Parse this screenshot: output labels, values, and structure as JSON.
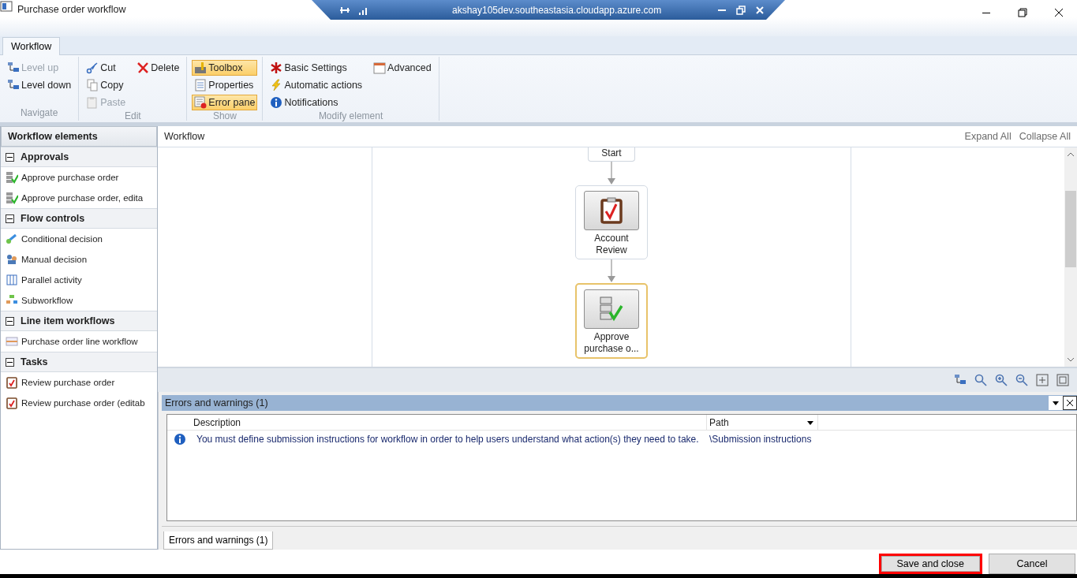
{
  "window": {
    "title": "Purchase order workflow"
  },
  "remote_bar": {
    "host": "akshay105dev.southeastasia.cloudapp.azure.com"
  },
  "ribbon": {
    "tabs": [
      {
        "label": "Workflow",
        "selected": true
      }
    ],
    "groups": [
      {
        "label": "Navigate",
        "disabled": true,
        "columns": [
          [
            {
              "label": "Level up",
              "disabled": true,
              "active": false
            },
            {
              "label": "Level down",
              "disabled": false,
              "active": false
            }
          ]
        ]
      },
      {
        "label": "Edit",
        "disabled": true,
        "columns": [
          [
            {
              "label": "Cut",
              "disabled": false,
              "active": false
            },
            {
              "label": "Copy",
              "disabled": false,
              "active": false
            },
            {
              "label": "Paste",
              "disabled": true,
              "active": false
            }
          ],
          [
            {
              "label": "Delete",
              "disabled": false,
              "active": false
            }
          ]
        ]
      },
      {
        "label": "Show",
        "disabled": true,
        "columns": [
          [
            {
              "label": "Toolbox",
              "disabled": false,
              "active": true
            },
            {
              "label": "Properties",
              "disabled": false,
              "active": false
            },
            {
              "label": "Error pane",
              "disabled": false,
              "active": true
            }
          ]
        ]
      },
      {
        "label": "Modify element",
        "disabled": true,
        "columns": [
          [
            {
              "label": "Basic Settings",
              "disabled": false,
              "active": false
            },
            {
              "label": "Automatic actions",
              "disabled": false,
              "active": false
            },
            {
              "label": "Notifications",
              "disabled": false,
              "active": false
            }
          ],
          [
            {
              "label": "Advanced",
              "disabled": false,
              "active": false
            }
          ]
        ]
      }
    ]
  },
  "sidebar": {
    "title": "Workflow elements",
    "sections": [
      {
        "label": "Approvals",
        "expanded": true,
        "items": [
          "Approve purchase order",
          "Approve purchase order, edita"
        ]
      },
      {
        "label": "Flow controls",
        "expanded": true,
        "items": [
          "Conditional decision",
          "Manual decision",
          "Parallel activity",
          "Subworkflow"
        ]
      },
      {
        "label": "Line item workflows",
        "expanded": true,
        "items": [
          "Purchase order line workflow"
        ]
      },
      {
        "label": "Tasks",
        "expanded": true,
        "items": [
          "Review purchase order",
          "Review purchase order (editab"
        ]
      }
    ]
  },
  "canvas": {
    "title": "Workflow",
    "links": [
      "Expand All",
      "Collapse All"
    ],
    "nodes": [
      {
        "kind": "start",
        "label": "Start",
        "selected": false
      },
      {
        "kind": "task",
        "label": "Account Review",
        "selected": false
      },
      {
        "kind": "approval",
        "label": "Approve purchase o...",
        "selected": true
      }
    ]
  },
  "errors": {
    "title": "Errors and warnings (1)",
    "columns": [
      "Description",
      "Path"
    ],
    "rows": [
      {
        "kind": "info",
        "description": "You must define submission instructions for workflow  in order to help users understand what action(s) they need to take.",
        "path": "\\Submission instructions"
      }
    ],
    "tabs": [
      {
        "label": "Errors and warnings (1)",
        "selected": true
      }
    ]
  },
  "footer": {
    "buttons": [
      {
        "label": "Save and close",
        "annotated": true
      },
      {
        "label": "Cancel",
        "annotated": false
      }
    ]
  }
}
